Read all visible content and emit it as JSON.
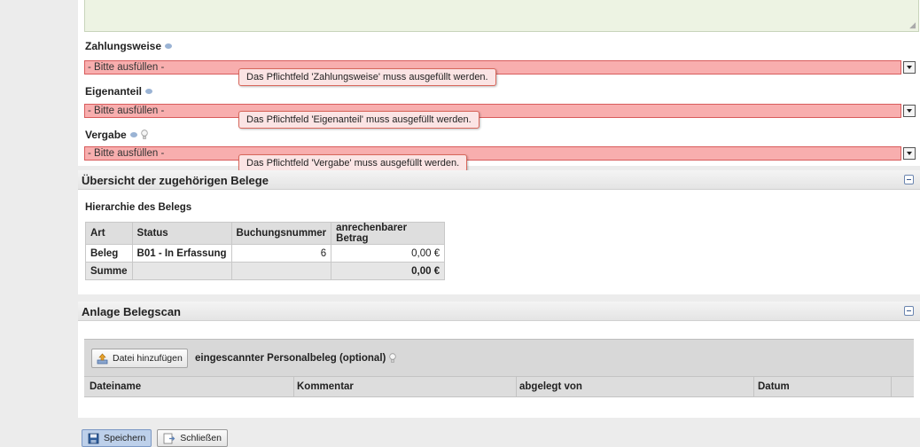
{
  "form": {
    "zahlungsweise": {
      "label": "Zahlungsweise",
      "value": "- Bitte ausfüllen -",
      "error": "Das Pflichtfeld 'Zahlungsweise' muss ausgefüllt werden."
    },
    "eigenanteil": {
      "label": "Eigenanteil",
      "value": "- Bitte ausfüllen -",
      "error": "Das Pflichtfeld 'Eigenanteil' muss ausgefüllt werden."
    },
    "vergabe": {
      "label": "Vergabe",
      "value": "- Bitte ausfüllen -",
      "error": "Das Pflichtfeld 'Vergabe' muss ausgefüllt werden."
    }
  },
  "belege": {
    "title": "Übersicht der zugehörigen Belege",
    "subtitle": "Hierarchie des Belegs",
    "columns": [
      "Art",
      "Status",
      "Buchungsnummer",
      "anrechenbarer Betrag"
    ],
    "rows": [
      {
        "art": "Beleg",
        "status": "B01 - In Erfassung",
        "buchungsnummer": "6",
        "betrag": "0,00 €"
      }
    ],
    "sum": {
      "label": "Summe",
      "betrag": "0,00 €"
    }
  },
  "scan": {
    "title": "Anlage Belegscan",
    "add_button": "Datei hinzufügen",
    "label": "eingescannter Personalbeleg (optional)",
    "columns": [
      "Dateiname",
      "Kommentar",
      "abgelegt von",
      "Datum"
    ]
  },
  "actions": {
    "save": "Speichern",
    "close": "Schließen"
  },
  "colors": {
    "error_field": "#f8aeae",
    "error_border": "#d85c5c",
    "tooltip_bg": "#fbe4e4",
    "primary_button": "#bdd0ea"
  }
}
